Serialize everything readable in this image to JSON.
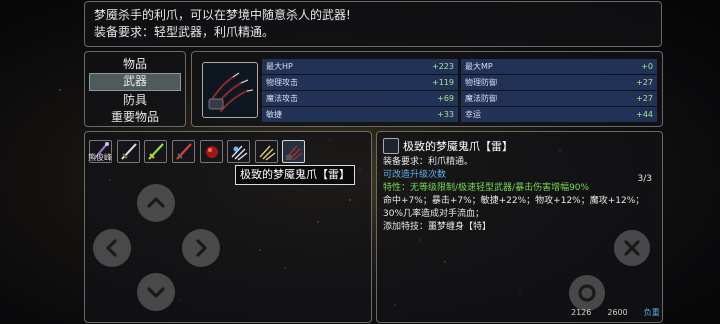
{
  "description": {
    "line1": "梦魇杀手的利爪，可以在梦境中随意杀人的武器!",
    "line2": "装备要求：轻型武器，利爪精通。"
  },
  "menu": {
    "items": [
      "物品",
      "武器",
      "防具",
      "重要物品"
    ],
    "active_index": 1
  },
  "stats": [
    {
      "name": "最大HP",
      "value": "+223"
    },
    {
      "name": "最大MP",
      "value": "+0"
    },
    {
      "name": "物理攻击",
      "value": "+119"
    },
    {
      "name": "物理防御",
      "value": "+27"
    },
    {
      "name": "魔法攻击",
      "value": "+69"
    },
    {
      "name": "魔法防御",
      "value": "+27"
    },
    {
      "name": "敏捷",
      "value": "+33"
    },
    {
      "name": "幸运",
      "value": "+44"
    }
  ],
  "inventory": {
    "slot_label": "熊俊峰",
    "selected_index": 6,
    "tooltip": "极致的梦魇鬼爪【雷】",
    "slot_icons": [
      "staff-icon",
      "sword-icon",
      "green-blade-icon",
      "red-blade-icon",
      "red-orb-icon",
      "claw-icon",
      "gold-claw-icon",
      "dark-claw-icon"
    ]
  },
  "detail": {
    "title": "极致的梦魇鬼爪【雷】",
    "requirement": "装备要求：利爪精通。",
    "upgrade": "可改造升级次数",
    "upgrade_count": "3/3",
    "trait": "特性：无等级限制/极速轻型武器/暴击伤害增幅90%",
    "line_hit": "命中+7%；暴击+7%；敏捷+22%；物攻+12%；魔攻+12%；",
    "line_chance": "30%几率造成对手流血；",
    "skill": "添加特技：噩梦缠身【特】"
  },
  "footer": {
    "value_a": "2126",
    "value_b": "2600",
    "weight_label": "负重"
  },
  "colors": {
    "stat_bar": "#283e6e",
    "stat_value": "#a8e28c",
    "green_text": "#76d858",
    "blue_text": "#5fb0e8"
  }
}
